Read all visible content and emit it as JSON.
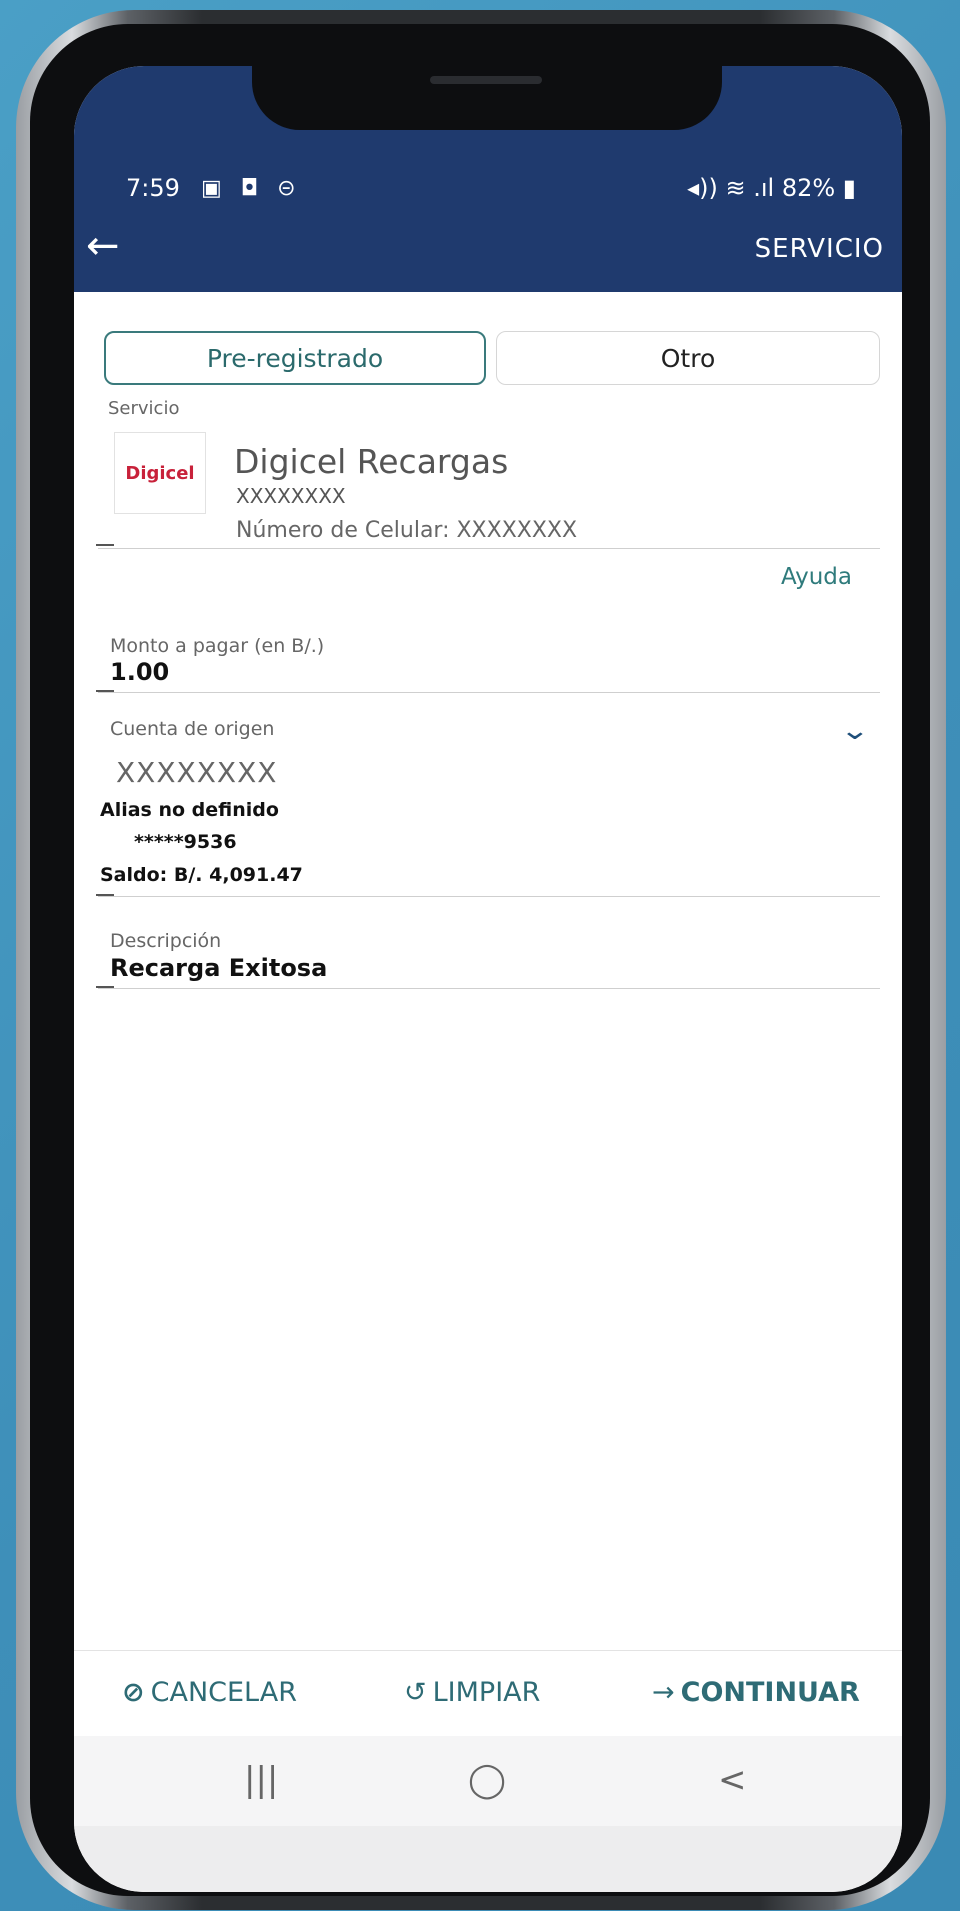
{
  "status_bar": {
    "time": "7:59",
    "left_icons": "▣ ◘ ⊝",
    "right_text": "82%"
  },
  "appbar": {
    "title": "SERVICIO",
    "back_icon": "←"
  },
  "segments": {
    "active": "Pre-registrado",
    "inactive": "Otro"
  },
  "service": {
    "section_label": "Servicio",
    "logo_text": "Digicel",
    "name": "Digicel Recargas",
    "masked_id": "XXXXXXXX",
    "phone_line": "Número de Celular: XXXXXXXX"
  },
  "help_link": "Ayuda",
  "amount": {
    "label": "Monto a pagar (en B/.)",
    "value": "1.00"
  },
  "account": {
    "label": "Cuenta de origen",
    "masked": "XXXXXXXX",
    "alias": "Alias no definido",
    "number": "*****9536",
    "balance": "Saldo: B/. 4,091.47"
  },
  "description": {
    "label": "Descripción",
    "value": "Recarga Exitosa"
  },
  "actions": {
    "cancel": "CANCELAR",
    "clear": "LIMPIAR",
    "continue": "CONTINUAR"
  },
  "nav": {
    "recents": "|||",
    "home": "◯",
    "back": "<"
  },
  "colors": {
    "appbar": "#1f3a6e",
    "accent": "#2e6b75",
    "brand_logo": "#c8213a"
  }
}
